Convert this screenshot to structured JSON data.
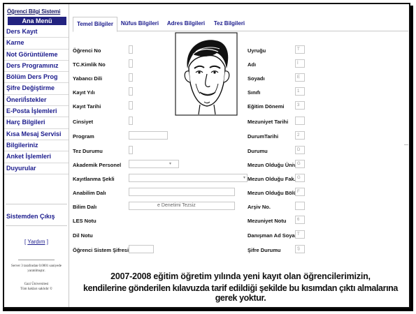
{
  "sidebar": {
    "title": "Öğrenci Bilgi Sistemi",
    "header": "Ana Menü",
    "items": [
      {
        "label": "Ders Kayıt"
      },
      {
        "label": "Karne"
      },
      {
        "label": "Not Görüntüleme"
      },
      {
        "label": "Ders Programınız"
      },
      {
        "label": "Bölüm Ders Prog"
      },
      {
        "label": "Şifre Değiştirme"
      },
      {
        "label": "Öneri/İstekler"
      },
      {
        "label": "E-Posta İşlemleri"
      },
      {
        "label": "Harç Bilgileri"
      },
      {
        "label": "Kısa Mesaj Servisi"
      },
      {
        "label": "Bilgileriniz"
      },
      {
        "label": "Anket İşlemleri"
      },
      {
        "label": "Duyurular"
      }
    ],
    "logout": "Sistemden Çıkış",
    "help_open": "[ ",
    "help_label": "Yardım",
    "help_close": " ]",
    "server_line1": "Server 3 tarafından 0.0001 saniyede",
    "server_line2": "yaratılmıştır.",
    "univ_line1": "Gazi Üniversitesi",
    "univ_line2": "Tüm hakları saklıdır ©"
  },
  "tabs": [
    {
      "label": "Temel Bilgiler"
    },
    {
      "label": "Nüfus Bilgileri"
    },
    {
      "label": "Adres Bilgileri"
    },
    {
      "label": "Tez Bilgileri"
    }
  ],
  "left_labels": [
    "Öğrenci No",
    "TC.Kimlik No",
    "Yabancı Dili",
    "Kayıt Yılı",
    "Kayıt Tarihi",
    "Cinsiyet",
    "Program",
    "Tez Durumu",
    "Akademik Personel",
    "Kayıtlanma Şekli",
    "Anabilim Dalı",
    "Bilim Dalı",
    "LES Notu",
    "Dil Notu",
    "Öğrenci Sistem Şifresi"
  ],
  "right_labels": [
    "Uyruğu",
    "Adı",
    "Soyadı",
    "Sınıfı",
    "Eğitim Dönemi",
    "Mezuniyet Tarihi",
    "DurumTarihi",
    "Durumu",
    "Mezun Olduğu Üniv.",
    "Mezun Olduğu Fak.",
    "Mezun Olduğu Bölüm",
    "Arşiv No.",
    "Mezuniyet Notu",
    "Danışman Ad Soyad",
    "Şifre Durumu"
  ],
  "right_values": [
    "T",
    "İ",
    "E",
    "1",
    "3",
    "",
    "2",
    "D",
    "G",
    "G",
    "F",
    "",
    "6",
    "T",
    "Ş"
  ],
  "bilim_dali_value": "e Denetimi Tezsiz",
  "notice": {
    "line1": "2007-2008 eğitim öğretim yılında yeni kayıt olan öğrencilerimizin,",
    "line2": "kendilerine gönderilen kılavuzda tarif edildiği şekilde bu kısımdan çıktı almalarına gerek yoktur."
  },
  "colors": {
    "accent": "#22227f",
    "link": "#1a1a8c"
  }
}
